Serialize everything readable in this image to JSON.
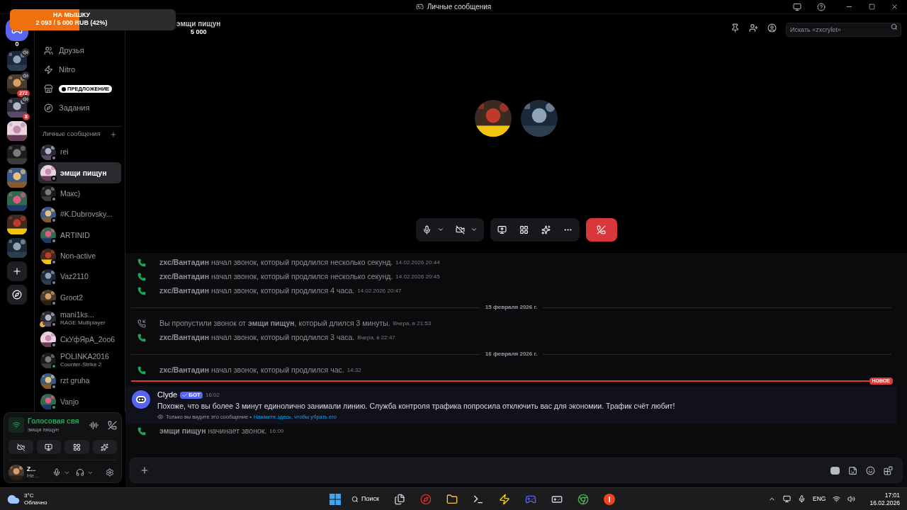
{
  "window": {
    "title": "Личные сообщения"
  },
  "goal": {
    "title": "НА МЫШКУ",
    "progress": "2 093 / 5 000 RUB (42%)",
    "level": 0.42
  },
  "header": {
    "name": "эмщи пищун",
    "amount": "5 000",
    "search_placeholder": "Искать «zxcrylet»"
  },
  "servers": [
    {
      "kind": "home",
      "count": "0"
    },
    {
      "kind": "server",
      "voice": true
    },
    {
      "kind": "server",
      "voice": true,
      "badge": "272"
    },
    {
      "kind": "server",
      "voice": true,
      "badge": "8"
    },
    {
      "kind": "server",
      "voice": false
    },
    {
      "kind": "server",
      "voice": false
    },
    {
      "kind": "server",
      "voice": false
    },
    {
      "kind": "server",
      "voice": false
    },
    {
      "kind": "server",
      "voice": false
    },
    {
      "kind": "server",
      "voice": false
    },
    {
      "kind": "add"
    },
    {
      "kind": "discover"
    }
  ],
  "nav": [
    {
      "kind": "friends",
      "label": "Друзья"
    },
    {
      "kind": "nitro",
      "label": "Nitro"
    },
    {
      "kind": "shop",
      "label": "ПРЕДЛОЖЕНИЕ"
    },
    {
      "kind": "quests",
      "label": "Задания"
    }
  ],
  "dm_header": "Личные сообщения",
  "dms": [
    {
      "name": "rei",
      "online": false,
      "idle": false,
      "selected": false
    },
    {
      "name": "эмщи пищун",
      "online": false,
      "idle": false,
      "selected": true
    },
    {
      "name": "Макс)",
      "online": false,
      "idle": false,
      "selected": false
    },
    {
      "name": "#K.Dubrovsky...",
      "online": false,
      "idle": false,
      "selected": false
    },
    {
      "name": "ARTINID",
      "online": false,
      "idle": false,
      "selected": false
    },
    {
      "name": "Non-active",
      "online": false,
      "idle": false,
      "selected": false
    },
    {
      "name": "Vaz2110",
      "online": false,
      "idle": false,
      "selected": false
    },
    {
      "name": "Groot2",
      "online": false,
      "idle": false,
      "selected": false
    },
    {
      "name": "mani1ks...",
      "activity": "RAGE Multiplayer",
      "online": false,
      "idle": true,
      "selected": false
    },
    {
      "name": "СкУфЯрА_2оо6",
      "online": false,
      "idle": false,
      "selected": false
    },
    {
      "name": "POLINKA2016",
      "activity": "Counter-Strike 2",
      "online": true,
      "idle": false,
      "selected": false
    },
    {
      "name": "rzt gruha",
      "online": false,
      "idle": false,
      "selected": false
    },
    {
      "name": "Vanjo",
      "online": true,
      "idle": false,
      "selected": false
    }
  ],
  "voice_panel": {
    "title": "Голосовая свя",
    "channel": "эмщи пищун"
  },
  "user_panel": {
    "name": "Z...",
    "status_text": "Не..."
  },
  "messages": [
    {
      "kind": "call",
      "text": "**zxc/Вантадин** начал звонок, который продлился несколько секунд.",
      "time": "14.02.2026 20:44"
    },
    {
      "kind": "call",
      "text": "**zxc/Вантадин** начал звонок, который продлился несколько секунд.",
      "time": "14.02.2026 20:45"
    },
    {
      "kind": "call",
      "text": "**zxc/Вантадин** начал звонок, который продлился 4 часа.",
      "time": "14.02.2026 20:47"
    },
    {
      "kind": "date",
      "label": "15 февраля 2026 г."
    },
    {
      "kind": "missed",
      "text": "Вы пропустили звонок от **эмщи пищун**, который длился 3 минуты.",
      "time": "Вчера, в 21:53"
    },
    {
      "kind": "call",
      "text": "**zxc/Вантадин** начал звонок, который продлился 3 часа.",
      "time": "Вчера, в 22:47"
    },
    {
      "kind": "date",
      "label": "16 февраля 2026 г."
    },
    {
      "kind": "call",
      "text": "**zxc/Вантадин** начал звонок, который продлился час.",
      "time": "14:32"
    },
    {
      "kind": "new",
      "label": "НОВОЕ"
    },
    {
      "kind": "bot",
      "user": "Clyde",
      "badge": "БОТ",
      "time": "16:02",
      "text": "Похоже, что вы более 3 минут единолично занимали линию. Служба контроля трафика попросила отключить вас для экономии. Трафик счёт любит!",
      "note": "Только вы видите это сообщение •",
      "link": "Нажмите здесь, чтобы убрать его"
    },
    {
      "kind": "call",
      "text": "**эмщи пищун** начинает звонок.",
      "time": "16:09"
    }
  ],
  "taskbar": {
    "temperature": "3°C",
    "weather": "Облачно",
    "search": "Поиск",
    "language": "ENG",
    "time": "17:01",
    "date": "16.02.2026"
  }
}
